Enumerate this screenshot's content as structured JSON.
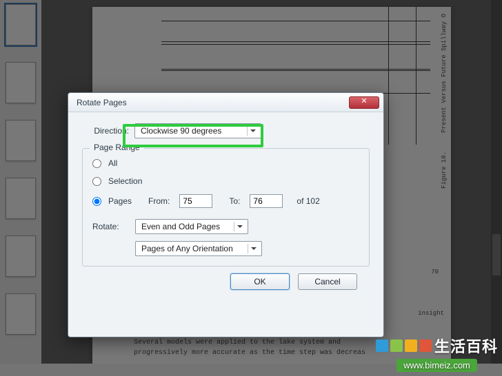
{
  "dialog": {
    "title": "Rotate Pages",
    "direction_label": "Direction:",
    "direction_value": "Clockwise 90 degrees",
    "page_range_legend": "Page Range",
    "opt_all": "All",
    "opt_selection": "Selection",
    "opt_pages": "Pages",
    "from_label": "From:",
    "from_value": "75",
    "to_label": "To:",
    "to_value": "76",
    "of_label": "of 102",
    "rotate_label": "Rotate:",
    "rotate_pages_value": "Even and Odd Pages",
    "rotate_orient_value": "Pages of Any Orientation",
    "ok": "OK",
    "cancel": "Cancel"
  },
  "bg_page": {
    "side_label_1": "Present Versus Future Spillway O",
    "side_label_2": "Figure 18.",
    "caption_1": "Several models were applied to the lake system and",
    "caption_2": "progressively more accurate as the time step was decreas",
    "margin_note": "insight",
    "margin_pg": "70"
  },
  "watermark": {
    "brand": "生活百科",
    "url": "www.bimeiz.com",
    "colors": [
      "#2f9bd8",
      "#8bc34a",
      "#f2b01e",
      "#e0563b"
    ]
  },
  "footer": {
    "text": ""
  }
}
